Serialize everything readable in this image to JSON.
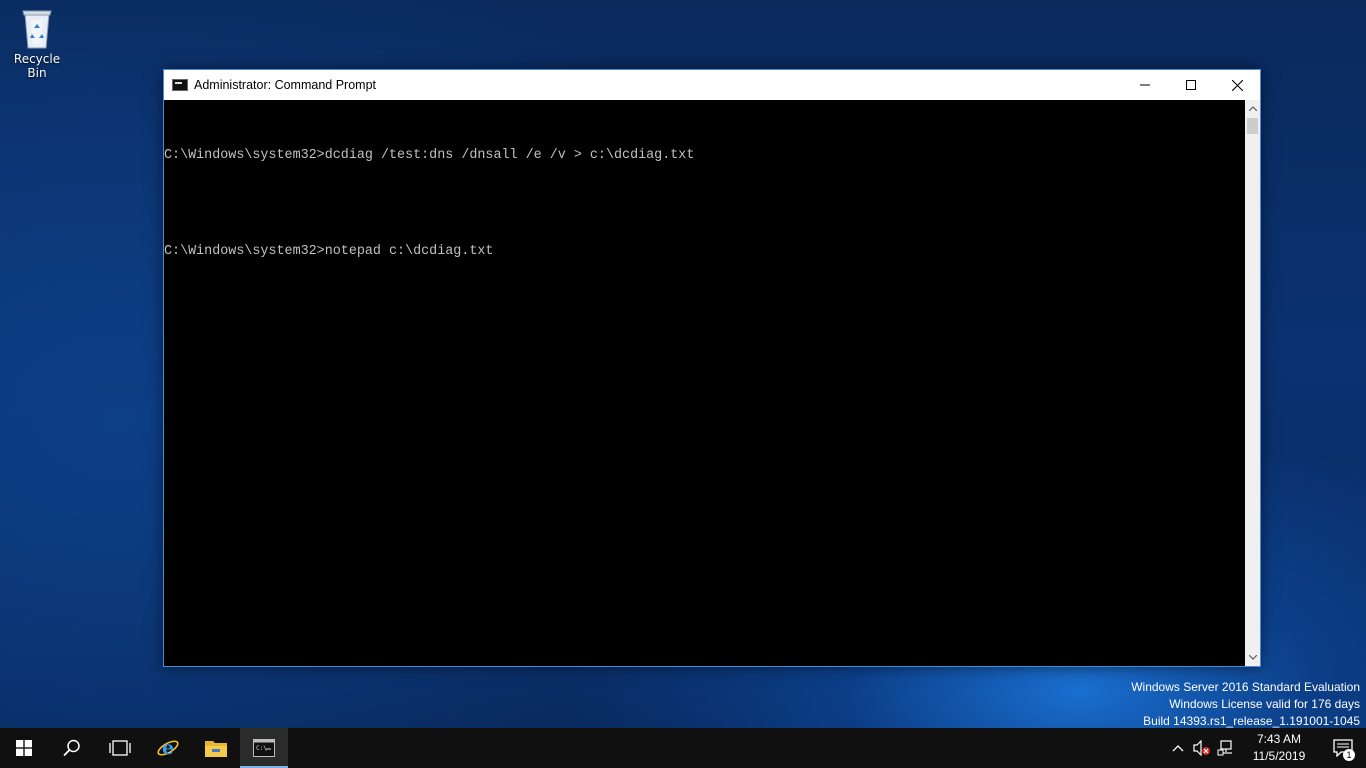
{
  "desktop": {
    "icons": [
      {
        "label": "Recycle Bin",
        "icon": "recycle-bin-icon"
      }
    ]
  },
  "window": {
    "title": "Administrator: Command Prompt",
    "icon": "command-prompt-icon",
    "controls": {
      "minimize": "minimize-icon",
      "maximize": "maximize-icon",
      "close": "close-icon"
    }
  },
  "console": {
    "lines": [
      "C:\\Windows\\system32>dcdiag /test:dns /dnsall /e /v > c:\\dcdiag.txt",
      "",
      "C:\\Windows\\system32>notepad c:\\dcdiag.txt"
    ]
  },
  "watermark": {
    "line1": "Windows Server 2016 Standard Evaluation",
    "line2": "Windows License valid for 176 days",
    "line3": "Build 14393.rs1_release_1.191001-1045"
  },
  "taskbar": {
    "buttons": [
      {
        "icon": "windows-start-icon"
      },
      {
        "icon": "search-icon"
      },
      {
        "icon": "task-view-icon"
      },
      {
        "icon": "internet-explorer-icon"
      },
      {
        "icon": "file-explorer-icon"
      },
      {
        "icon": "command-prompt-icon",
        "active": true
      }
    ],
    "tray": {
      "icons": [
        "chevron-up-icon",
        "speaker-muted-icon",
        "network-icon"
      ],
      "time": "7:43 AM",
      "date": "11/5/2019",
      "notification_count": "1"
    }
  },
  "colors": {
    "console_bg": "#000000",
    "console_text": "#c0c0c0",
    "taskbar_bg": "#101010",
    "window_border": "#4a8ad6",
    "active_indicator": "#7fb2e6"
  }
}
